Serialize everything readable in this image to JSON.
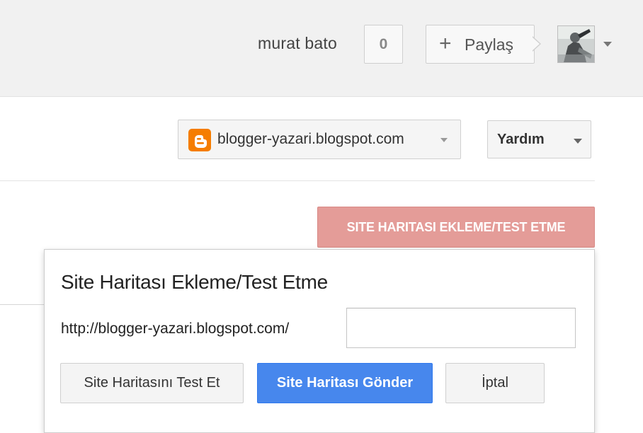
{
  "header": {
    "user_name": "murat bato",
    "notification_count": "0",
    "share_label": "Paylaş",
    "share_icon": "plus-icon",
    "avatar_icon": "avatar",
    "avatar_menu_icon": "chevron-down-icon"
  },
  "toolbar": {
    "blog_selector": {
      "icon": "blogger-icon",
      "label": "blogger-yazari.blogspot.com"
    },
    "help_label": "Yardım"
  },
  "actions": {
    "add_test_sitemap_label": "SITE HARITASI EKLEME/TEST ETME"
  },
  "dialog": {
    "title": "Site Haritası Ekleme/Test Etme",
    "url_prefix": "http://blogger-yazari.blogspot.com/",
    "input_value": "",
    "input_placeholder": "",
    "test_button_label": "Site Haritasını Test Et",
    "submit_button_label": "Site Haritası Gönder",
    "cancel_button_label": "İptal"
  },
  "colors": {
    "topbar_bg": "#f1f1f1",
    "blogger_orange": "#f57d00",
    "add_button_red": "#e49c98",
    "submit_blue": "#4787ed"
  }
}
